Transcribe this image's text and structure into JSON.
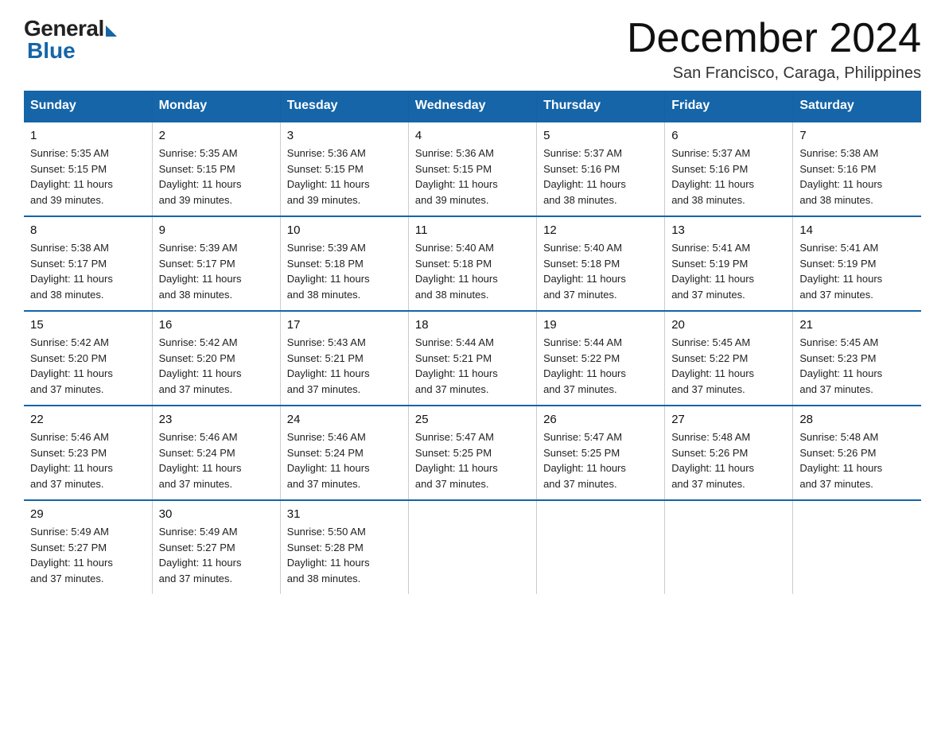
{
  "header": {
    "logo_general": "General",
    "logo_blue": "Blue",
    "month_title": "December 2024",
    "subtitle": "San Francisco, Caraga, Philippines"
  },
  "weekdays": [
    "Sunday",
    "Monday",
    "Tuesday",
    "Wednesday",
    "Thursday",
    "Friday",
    "Saturday"
  ],
  "weeks": [
    [
      {
        "day": "1",
        "sunrise": "5:35 AM",
        "sunset": "5:15 PM",
        "daylight": "11 hours and 39 minutes."
      },
      {
        "day": "2",
        "sunrise": "5:35 AM",
        "sunset": "5:15 PM",
        "daylight": "11 hours and 39 minutes."
      },
      {
        "day": "3",
        "sunrise": "5:36 AM",
        "sunset": "5:15 PM",
        "daylight": "11 hours and 39 minutes."
      },
      {
        "day": "4",
        "sunrise": "5:36 AM",
        "sunset": "5:15 PM",
        "daylight": "11 hours and 39 minutes."
      },
      {
        "day": "5",
        "sunrise": "5:37 AM",
        "sunset": "5:16 PM",
        "daylight": "11 hours and 38 minutes."
      },
      {
        "day": "6",
        "sunrise": "5:37 AM",
        "sunset": "5:16 PM",
        "daylight": "11 hours and 38 minutes."
      },
      {
        "day": "7",
        "sunrise": "5:38 AM",
        "sunset": "5:16 PM",
        "daylight": "11 hours and 38 minutes."
      }
    ],
    [
      {
        "day": "8",
        "sunrise": "5:38 AM",
        "sunset": "5:17 PM",
        "daylight": "11 hours and 38 minutes."
      },
      {
        "day": "9",
        "sunrise": "5:39 AM",
        "sunset": "5:17 PM",
        "daylight": "11 hours and 38 minutes."
      },
      {
        "day": "10",
        "sunrise": "5:39 AM",
        "sunset": "5:18 PM",
        "daylight": "11 hours and 38 minutes."
      },
      {
        "day": "11",
        "sunrise": "5:40 AM",
        "sunset": "5:18 PM",
        "daylight": "11 hours and 38 minutes."
      },
      {
        "day": "12",
        "sunrise": "5:40 AM",
        "sunset": "5:18 PM",
        "daylight": "11 hours and 37 minutes."
      },
      {
        "day": "13",
        "sunrise": "5:41 AM",
        "sunset": "5:19 PM",
        "daylight": "11 hours and 37 minutes."
      },
      {
        "day": "14",
        "sunrise": "5:41 AM",
        "sunset": "5:19 PM",
        "daylight": "11 hours and 37 minutes."
      }
    ],
    [
      {
        "day": "15",
        "sunrise": "5:42 AM",
        "sunset": "5:20 PM",
        "daylight": "11 hours and 37 minutes."
      },
      {
        "day": "16",
        "sunrise": "5:42 AM",
        "sunset": "5:20 PM",
        "daylight": "11 hours and 37 minutes."
      },
      {
        "day": "17",
        "sunrise": "5:43 AM",
        "sunset": "5:21 PM",
        "daylight": "11 hours and 37 minutes."
      },
      {
        "day": "18",
        "sunrise": "5:44 AM",
        "sunset": "5:21 PM",
        "daylight": "11 hours and 37 minutes."
      },
      {
        "day": "19",
        "sunrise": "5:44 AM",
        "sunset": "5:22 PM",
        "daylight": "11 hours and 37 minutes."
      },
      {
        "day": "20",
        "sunrise": "5:45 AM",
        "sunset": "5:22 PM",
        "daylight": "11 hours and 37 minutes."
      },
      {
        "day": "21",
        "sunrise": "5:45 AM",
        "sunset": "5:23 PM",
        "daylight": "11 hours and 37 minutes."
      }
    ],
    [
      {
        "day": "22",
        "sunrise": "5:46 AM",
        "sunset": "5:23 PM",
        "daylight": "11 hours and 37 minutes."
      },
      {
        "day": "23",
        "sunrise": "5:46 AM",
        "sunset": "5:24 PM",
        "daylight": "11 hours and 37 minutes."
      },
      {
        "day": "24",
        "sunrise": "5:46 AM",
        "sunset": "5:24 PM",
        "daylight": "11 hours and 37 minutes."
      },
      {
        "day": "25",
        "sunrise": "5:47 AM",
        "sunset": "5:25 PM",
        "daylight": "11 hours and 37 minutes."
      },
      {
        "day": "26",
        "sunrise": "5:47 AM",
        "sunset": "5:25 PM",
        "daylight": "11 hours and 37 minutes."
      },
      {
        "day": "27",
        "sunrise": "5:48 AM",
        "sunset": "5:26 PM",
        "daylight": "11 hours and 37 minutes."
      },
      {
        "day": "28",
        "sunrise": "5:48 AM",
        "sunset": "5:26 PM",
        "daylight": "11 hours and 37 minutes."
      }
    ],
    [
      {
        "day": "29",
        "sunrise": "5:49 AM",
        "sunset": "5:27 PM",
        "daylight": "11 hours and 37 minutes."
      },
      {
        "day": "30",
        "sunrise": "5:49 AM",
        "sunset": "5:27 PM",
        "daylight": "11 hours and 37 minutes."
      },
      {
        "day": "31",
        "sunrise": "5:50 AM",
        "sunset": "5:28 PM",
        "daylight": "11 hours and 38 minutes."
      },
      null,
      null,
      null,
      null
    ]
  ],
  "labels": {
    "sunrise": "Sunrise:",
    "sunset": "Sunset:",
    "daylight": "Daylight:"
  }
}
